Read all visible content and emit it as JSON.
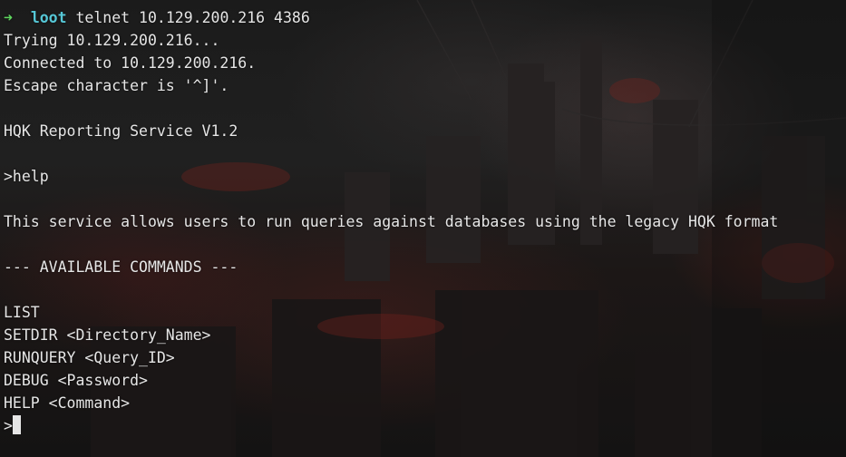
{
  "terminal": {
    "prompt": {
      "arrow": "➜",
      "directory": "loot",
      "command": "telnet 10.129.200.216 4386"
    },
    "output": [
      "Trying 10.129.200.216...",
      "Connected to 10.129.200.216.",
      "Escape character is '^]'.",
      "",
      "HQK Reporting Service V1.2",
      "",
      ">help",
      "",
      "This service allows users to run queries against databases using the legacy HQK format",
      "",
      "--- AVAILABLE COMMANDS ---",
      "",
      "LIST",
      "SETDIR <Directory_Name>",
      "RUNQUERY <Query_ID>",
      "DEBUG <Password>",
      "HELP <Command>"
    ],
    "input_prompt": ">",
    "colors": {
      "arrow": "#5fd75f",
      "directory": "#56c7d6",
      "text": "#e6e6e6"
    }
  }
}
